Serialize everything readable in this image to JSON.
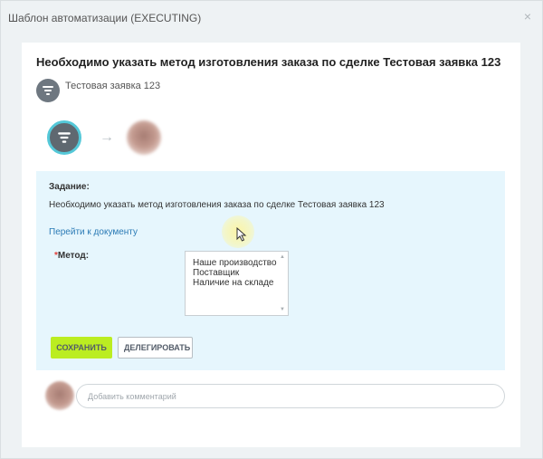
{
  "window": {
    "title": "Шаблон автоматизации (EXECUTING)",
    "close_symbol": "×"
  },
  "task": {
    "heading": "Необходимо указать метод изготовления заказа по сделке Тестовая заявка 123",
    "document_name": "Тестовая заявка 123",
    "document_icon": "filter-funnel-icon",
    "workflow_start_icon": "filter-funnel-icon",
    "workflow_arrow": "→",
    "assignment_label": "Задание:",
    "assignment_text": "Необходимо указать метод изготовления заказа по сделке Тестовая заявка 123",
    "go_to_document": "Перейти к документу"
  },
  "form": {
    "required_mark": "*",
    "method_label": "Метод:",
    "method_options": [
      "Наше производство",
      "Поставщик",
      "Наличие на складе"
    ],
    "scroll_up": "▲",
    "scroll_down": "▼"
  },
  "buttons": {
    "save": "СОХРАНИТЬ",
    "delegate": "ДЕЛЕГИРОВАТЬ"
  },
  "comment": {
    "placeholder": "Добавить комментарий"
  },
  "colors": {
    "accent_green": "#bbed21",
    "task_background": "#e6f6fd",
    "link": "#2a7ab5",
    "start_ring": "#54c8d8"
  }
}
